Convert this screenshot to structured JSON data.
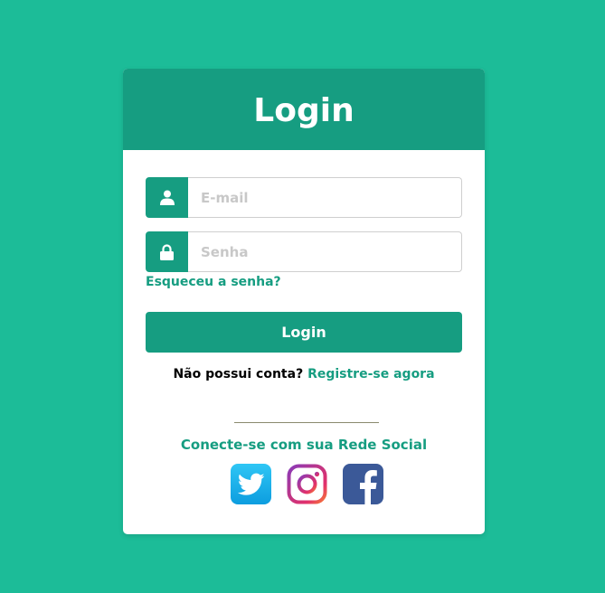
{
  "colors": {
    "background": "#1cbc98",
    "accent": "#169d81",
    "card": "#ffffff"
  },
  "card": {
    "title": "Login"
  },
  "form": {
    "email": {
      "value": "",
      "placeholder": "E-mail",
      "icon": "user-icon"
    },
    "password": {
      "value": "",
      "placeholder": "Senha",
      "icon": "lock-icon"
    },
    "forgot_label": "Esqueceu a senha?",
    "submit_label": "Login"
  },
  "register": {
    "prompt": "Não possui conta?",
    "link_label": "Registre-se agora"
  },
  "social": {
    "heading": "Conecte-se com sua Rede Social",
    "buttons": [
      {
        "icon": "twitter-icon"
      },
      {
        "icon": "instagram-icon"
      },
      {
        "icon": "facebook-icon"
      }
    ]
  }
}
